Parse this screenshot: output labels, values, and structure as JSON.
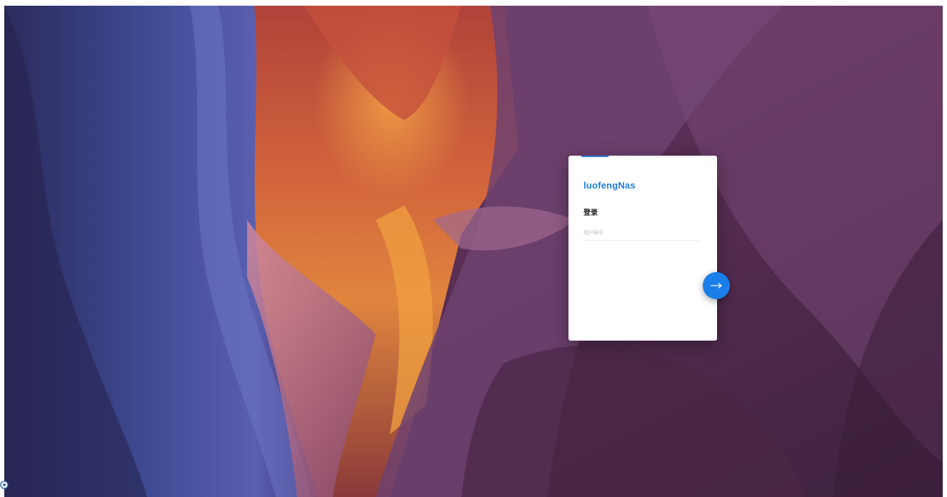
{
  "login": {
    "brand": "luofengNas",
    "title": "登录",
    "username_placeholder": "用户账号",
    "username_value": ""
  },
  "icons": {
    "next": "arrow-right-icon",
    "corner": "circle-indicator-icon"
  },
  "colors": {
    "accent": "#1f7de0",
    "button": "#1a7fe8",
    "card": "#ffffff"
  }
}
